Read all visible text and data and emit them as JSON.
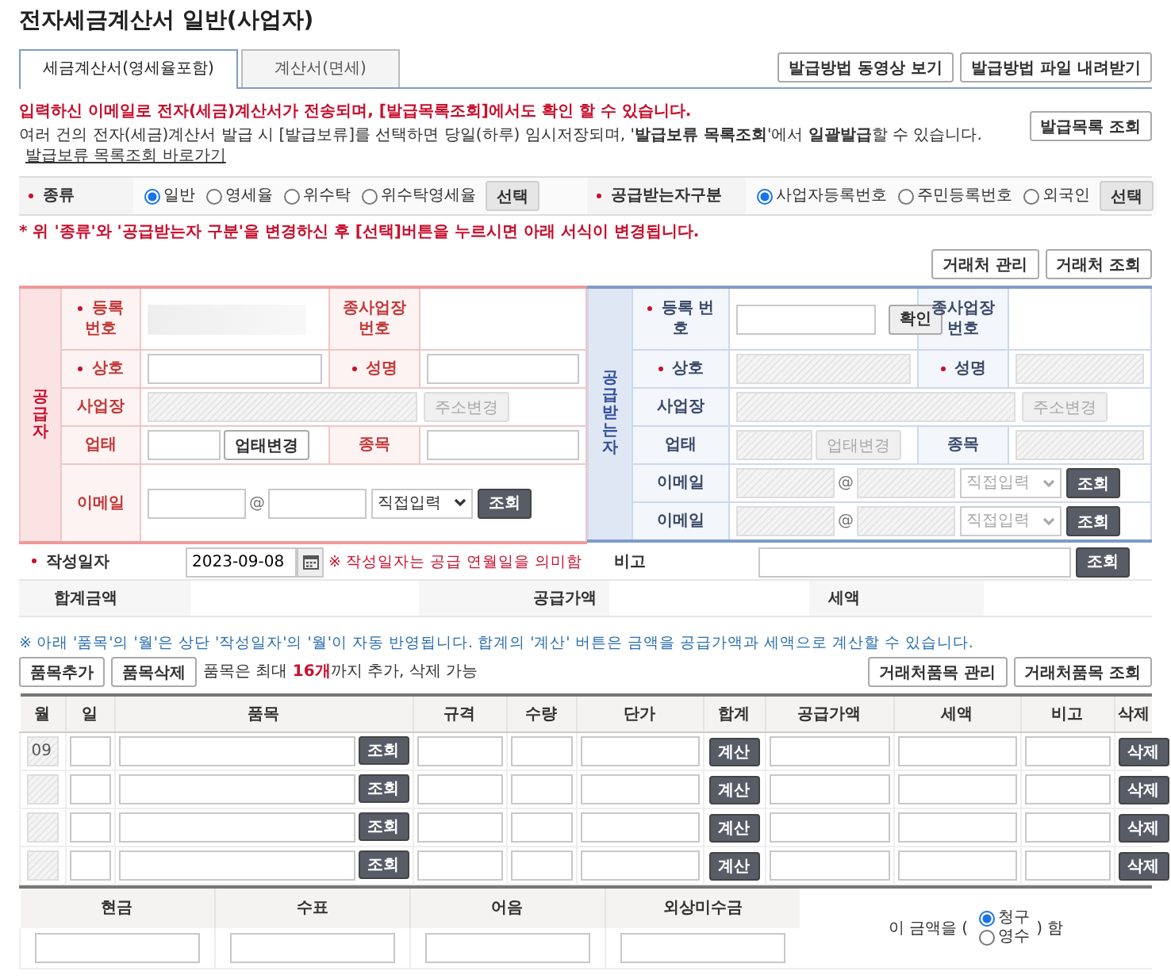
{
  "title": "전자세금계산서 일반(사업자)",
  "tabs": [
    {
      "label": "세금계산서(영세율포함)",
      "selected": true
    },
    {
      "label": "계산서(면세)",
      "selected": false
    }
  ],
  "tab_buttons": [
    "발급방법 동영상 보기",
    "발급방법 파일 내려받기"
  ],
  "notice": {
    "alert": "입력하신 이메일로 전자(세금)계산서가 전송되며, [발급목록조회]에서도 확인 할 수 있습니다.",
    "text": "여러 건의 전자(세금)계산서 발급 시 [발급보류]를 선택하면 당일(하루) 임시저장되며, '**발급보류 목록조회**'에서 **일괄발급**할 수 있습니다.",
    "link": "발급보류 목록조회 바로가기",
    "button": "발급목록 조회"
  },
  "options": [
    {
      "label": "종류",
      "required": true,
      "choices": [
        {
          "label": "일반",
          "selected": true
        },
        {
          "label": "영세율",
          "selected": false
        },
        {
          "label": "위수탁",
          "selected": false
        },
        {
          "label": "위수탁영세율",
          "selected": false
        }
      ],
      "button": "선택"
    },
    {
      "label": "공급받는자구분",
      "required": true,
      "choices": [
        {
          "label": "사업자등록번호",
          "selected": true
        },
        {
          "label": "주민등록번호",
          "selected": false
        },
        {
          "label": "외국인",
          "selected": false
        }
      ],
      "button": "선택"
    }
  ],
  "options_note": "* 위 '종류'와 '공급받는자 구분'을 변경하신 후 [선택]버튼을 누르시면 아래 서식이 변경됩니다.",
  "partner_buttons": [
    "거래처 관리",
    "거래처 조회"
  ],
  "panels": [
    {
      "kind": "supplier",
      "heading": "공급자",
      "reg_no": {
        "label": "등록 번호",
        "required": true,
        "readonly": true
      },
      "branch_no": {
        "label": "종사업장 번호"
      },
      "name": {
        "label": "상호",
        "required": true,
        "disabled": false
      },
      "ceo": {
        "label": "성명",
        "required": true,
        "disabled": false
      },
      "address": {
        "label": "사업장",
        "disabled": true,
        "button": {
          "label": "주소변경",
          "disabled": true
        }
      },
      "business_type": {
        "label": "업태",
        "disabled": false,
        "button": {
          "label": "업태변경",
          "disabled": false
        }
      },
      "item": {
        "label": "종목",
        "disabled": false
      },
      "emails": [
        {
          "label": "이메일",
          "disabled": false,
          "separator": "@",
          "domain": "직접입력",
          "button": "조회"
        }
      ]
    },
    {
      "kind": "receiver",
      "heading": "공급받는자",
      "reg_no": {
        "label": "등록 번호",
        "required": true,
        "readonly": false,
        "button": "확인"
      },
      "branch_no": {
        "label": "종사업장 번호"
      },
      "name": {
        "label": "상호",
        "required": true,
        "disabled": true
      },
      "ceo": {
        "label": "성명",
        "required": true,
        "disabled": true
      },
      "address": {
        "label": "사업장",
        "disabled": true,
        "button": {
          "label": "주소변경",
          "disabled": true
        }
      },
      "business_type": {
        "label": "업태",
        "disabled": true,
        "button": {
          "label": "업태변경",
          "disabled": true
        }
      },
      "item": {
        "label": "종목",
        "disabled": true
      },
      "emails": [
        {
          "label": "이메일",
          "disabled": true,
          "separator": "@",
          "domain": "직접입력",
          "button": "조회"
        },
        {
          "label": "이메일",
          "disabled": true,
          "separator": "@",
          "domain": "직접입력",
          "button": "조회"
        }
      ]
    }
  ],
  "date_row": {
    "label": "작성일자",
    "required": true,
    "value": "2023-09-08",
    "hint": "※ 작성일자는 공급 연월일을 의미함",
    "memo_label": "비고",
    "memo_button": "조회"
  },
  "summary": [
    "합계금액",
    "공급가액",
    "세액"
  ],
  "items_note": "※ 아래 '품목'의 '월'은 상단 '작성일자'의 '월'이 자동 반영됩니다. 합계의 '계산' 버튼은 금액을 공급가액과 세액으로 계산할 수 있습니다.",
  "items_buttons": [
    "품목추가",
    "품목삭제"
  ],
  "items_limit": "품목은 최대 **16개**까지 추가, 삭제 가능",
  "items_right_buttons": [
    "거래처품목 관리",
    "거래처품목 조회"
  ],
  "items": {
    "columns": [
      "월",
      "일",
      "품목",
      "규격",
      "수량",
      "단가",
      "합계",
      "공급가액",
      "세액",
      "비고",
      "삭제"
    ],
    "rows": [
      {
        "month": "09",
        "month_disabled": true,
        "lookup_button": "조회",
        "calc_button": "계산",
        "delete_button": "삭제"
      },
      {
        "month_disabled": true,
        "lookup_button": "조회",
        "calc_button": "계산",
        "delete_button": "삭제"
      },
      {
        "month_disabled": true,
        "lookup_button": "조회",
        "calc_button": "계산",
        "delete_button": "삭제"
      },
      {
        "month_disabled": true,
        "lookup_button": "조회",
        "calc_button": "계산",
        "delete_button": "삭제"
      }
    ]
  },
  "payment": {
    "columns": [
      "현금",
      "수표",
      "어음",
      "외상미수금"
    ],
    "prefix": "이 금액을 (",
    "suffix": ") 함",
    "choices": [
      {
        "label": "청구",
        "selected": true
      },
      {
        "label": "영수",
        "selected": false
      }
    ]
  }
}
